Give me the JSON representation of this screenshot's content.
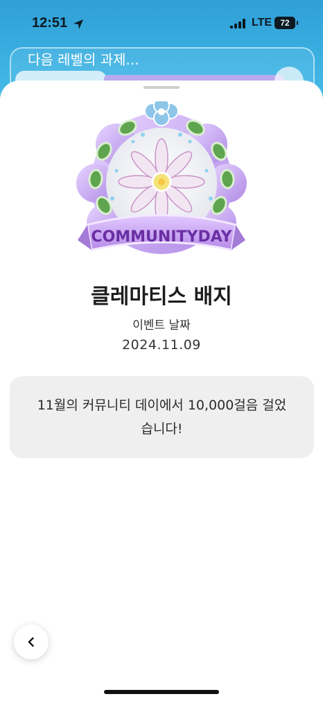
{
  "status_bar": {
    "time": "12:51",
    "network": "LTE",
    "battery": "72"
  },
  "background": {
    "title": "다음 레벨의 과제..."
  },
  "badge": {
    "banner_text": "COMMUNITYDAY",
    "name": "클레마티스 배지",
    "event_label": "이벤트 날짜",
    "event_date": "2024.11.09"
  },
  "description": "11월의 커뮤니티 데이에서 10,000걸음 걸었습니다!",
  "icons": {
    "back": "chevron-left-icon",
    "location": "location-arrow-icon",
    "signal": "cellular-signal-icon"
  }
}
